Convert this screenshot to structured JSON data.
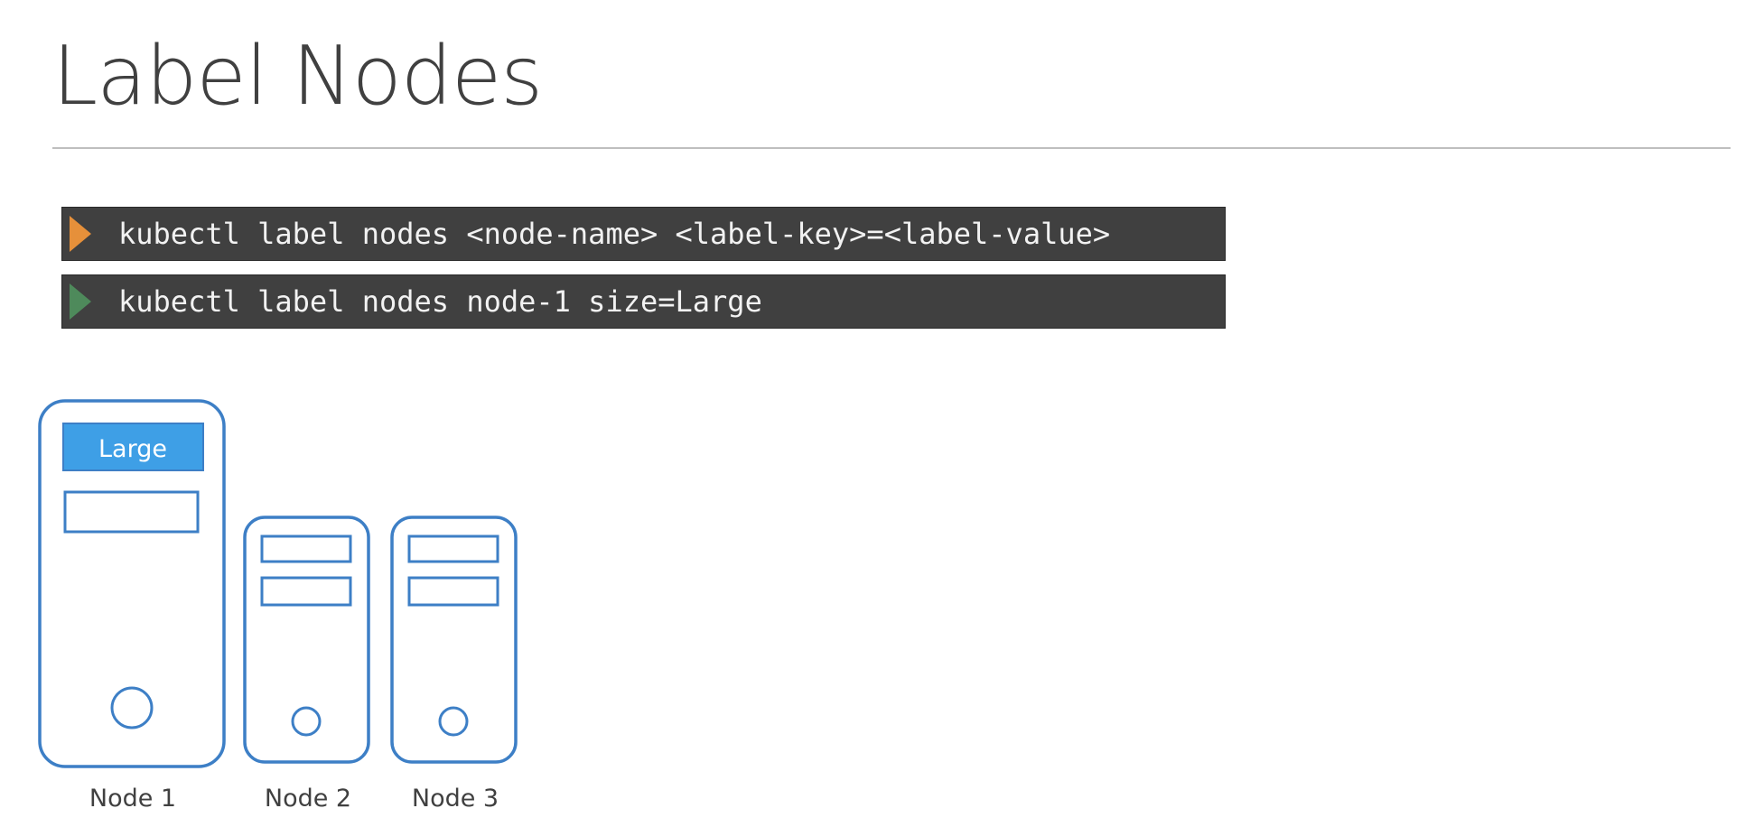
{
  "slide": {
    "title": "Label Nodes"
  },
  "commands": [
    {
      "text": "kubectl label nodes <node-name> <label-key>=<label-value>",
      "prompt_icon": "triangle-right-icon",
      "prompt_color": "#e6903a"
    },
    {
      "text": "kubectl label nodes node-1 size=Large",
      "prompt_icon": "triangle-right-icon",
      "prompt_color": "#4e8a5b"
    }
  ],
  "nodes": [
    {
      "name": "Node 1",
      "label": "Large",
      "icon": "server-icon"
    },
    {
      "name": "Node 2",
      "icon": "server-icon"
    },
    {
      "name": "Node 3",
      "icon": "server-icon"
    }
  ],
  "colors": {
    "server_outline": "#3d7fc6",
    "label_badge_fill": "#3e9fe6",
    "command_bar": "#404040",
    "title_text": "#404040"
  }
}
